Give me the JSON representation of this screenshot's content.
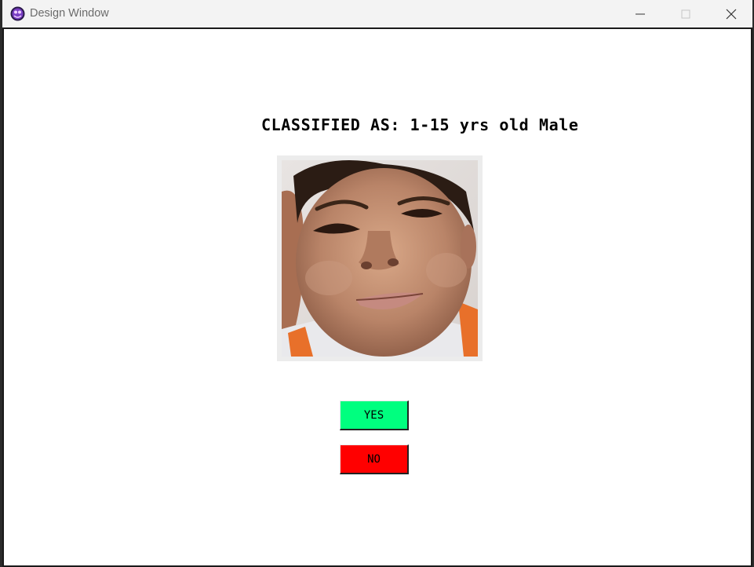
{
  "window": {
    "title": "Design Window",
    "icon": "app-icon"
  },
  "titlebar_controls": {
    "minimize_icon": "minimize-icon",
    "maximize_icon": "maximize-icon",
    "close_icon": "close-icon"
  },
  "main": {
    "classification_label": "CLASSIFIED AS: 1-15 yrs old Male",
    "photo": "classified-face-photo",
    "yes_button": {
      "label": "YES",
      "color": "#00ff7f"
    },
    "no_button": {
      "label": "NO",
      "color": "#ff0000"
    }
  }
}
